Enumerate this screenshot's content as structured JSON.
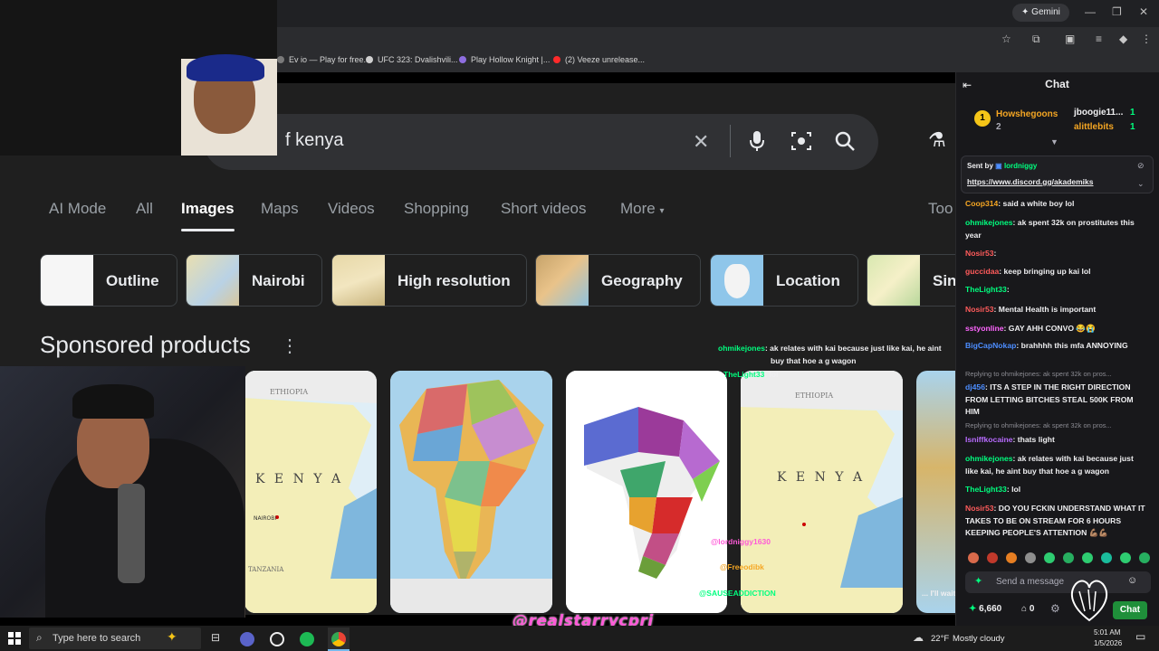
{
  "browser": {
    "gemini_label": "Gemini",
    "bookmarks": [
      {
        "label": "Ev io — Play for free...",
        "color": "#7a7a7a"
      },
      {
        "label": "UFC 323: Dvalishvili...",
        "color": "#d0d0d0"
      },
      {
        "label": "Play Hollow Knight |...",
        "color": "#8e6ee0"
      },
      {
        "label": "(2) Veeze unrelease...",
        "color": "#ff2a2a"
      }
    ]
  },
  "search": {
    "query": "f kenya",
    "icons": [
      "close-icon",
      "microphone-icon",
      "camera-icon",
      "search-icon",
      "labs-flask-icon"
    ],
    "tabs": [
      {
        "label": "AI Mode",
        "active": false
      },
      {
        "label": "All",
        "active": false
      },
      {
        "label": "Images",
        "active": true
      },
      {
        "label": "Maps",
        "active": false
      },
      {
        "label": "Videos",
        "active": false
      },
      {
        "label": "Shopping",
        "active": false
      },
      {
        "label": "Short videos",
        "active": false
      },
      {
        "label": "More",
        "active": false
      },
      {
        "label": "Too",
        "active": false
      }
    ],
    "chips": [
      {
        "label": "Outline"
      },
      {
        "label": "Nairobi"
      },
      {
        "label": "High resolution"
      },
      {
        "label": "Geography"
      },
      {
        "label": "Location"
      },
      {
        "label": "Sin"
      }
    ],
    "section_title": "Sponsored products",
    "map_labels": {
      "ethiopia": "ETHIOPIA",
      "kenya": "K E N Y A",
      "nairobi": "NAIROBI",
      "tanzania": "TANZANIA"
    }
  },
  "chat": {
    "header": "Chat",
    "gifters": [
      {
        "rank": "1",
        "name": "Howshegoons",
        "count": "2",
        "color": "#f5a623"
      },
      {
        "name": "jboogie11...",
        "count": "1",
        "color": "#efeff1"
      },
      {
        "name": "alittlebits",
        "count": "1",
        "color": "#f5a623"
      }
    ],
    "pinned": {
      "sent_by_label": "Sent by",
      "sender": "lordniggy",
      "link": "https://www.discord.gg/akademiks"
    },
    "messages": [
      {
        "user": "Coop314",
        "text": ": said a white boy lol",
        "color": "#f5a623"
      },
      {
        "user": "ohmikejones",
        "text": ": ak spent 32k on prostitutes this year",
        "color": "#00ff7f"
      },
      {
        "user": "Nosir53",
        "text": ":",
        "color": "#ff5b5b"
      },
      {
        "user": "guccidaa",
        "text": ": keep bringing up kai lol",
        "color": "#ff5b5b"
      },
      {
        "user": "TheLight33",
        "text": ":",
        "color": "#00ff7f"
      },
      {
        "user": "Nosir53",
        "text": ": Mental Health is important",
        "color": "#ff5b5b"
      },
      {
        "user": "sstyonline",
        "text": ": GAY AHH CONVO 😂😭",
        "color": "#ff66ff"
      },
      {
        "user": "BigCapNokap",
        "text": ": brahhhh this mfa ANNOYING",
        "color": "#4c8dff"
      },
      {
        "reply": "Replying to ohmikejones: ak spent 32k on pros..."
      },
      {
        "user": "dj456",
        "text": ": ITS A STEP IN THE RIGHT DIRECTION FROM LETTING BITCHES STEAL 500K FROM HIM",
        "color": "#4c8dff"
      },
      {
        "reply": "Replying to ohmikejones: ak spent 32k on pros..."
      },
      {
        "user": "Isniffkocaine",
        "text": ": thats light",
        "color": "#b86bff"
      },
      {
        "user": "ohmikejones",
        "text": ": ak relates with kai because just like kai, he aint buy that hoe a g wagon",
        "color": "#00ff7f"
      },
      {
        "user": "TheLight33",
        "text": ": lol",
        "color": "#00ff7f"
      },
      {
        "user": "Nosir53",
        "text": ": DO YOU FCKIN UNDERSTAND WHAT IT TAKES TO BE ON STREAM FOR 6 HOURS KEEPING PEOPLE'S ATTENTION 💪🏽💪🏽",
        "color": "#ff5b5b"
      }
    ],
    "input_placeholder": "Send a message",
    "points": "6,660",
    "count": "0",
    "send_label": "Chat"
  },
  "overlay_chat": [
    {
      "user": "ohmikejones",
      "text": ": ak relates with kai because just like kai, he aint",
      "color": "#00ff7f"
    },
    {
      "user": "",
      "text": "buy that hoe a g wagon",
      "color": "#efeff1"
    },
    {
      "user": "TheLight33",
      "text": ": lol",
      "color": "#00ff7f"
    },
    {
      "user": "@lordniggy1630",
      "text": "",
      "color": "#ff5ad8"
    },
    {
      "user": "@Freeodibk",
      "text": "",
      "color": "#f5a623"
    },
    {
      "user": "@SAUSEADDICTION",
      "text": "",
      "color": "#00ff7f"
    },
    {
      "user": "",
      "text": "... I'll wait",
      "color": "#efeff1"
    }
  ],
  "watermark": "@realstarrycpri",
  "taskbar": {
    "search_placeholder": "Type here to search",
    "temperature": "22°F",
    "weather": "Mostly cloudy",
    "time": "5:01 AM",
    "date": "1/5/2026"
  }
}
